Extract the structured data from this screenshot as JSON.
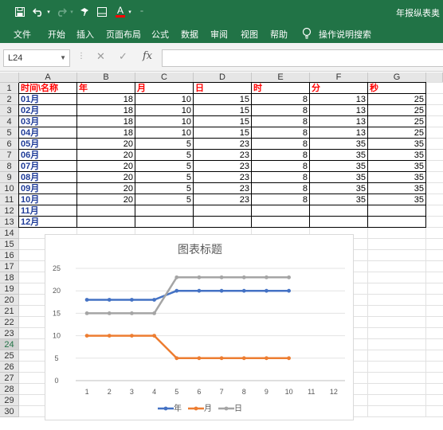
{
  "app": {
    "doc_title": "年报纵表奥"
  },
  "ribbon": {
    "tabs": [
      {
        "id": "file",
        "label": "文件"
      },
      {
        "id": "home",
        "label": "开始"
      },
      {
        "id": "insert",
        "label": "插入"
      },
      {
        "id": "layout",
        "label": "页面布局"
      },
      {
        "id": "formulas",
        "label": "公式"
      },
      {
        "id": "data",
        "label": "数据"
      },
      {
        "id": "review",
        "label": "审阅"
      },
      {
        "id": "view",
        "label": "视图"
      },
      {
        "id": "help",
        "label": "帮助"
      }
    ],
    "tell_me": "操作说明搜索"
  },
  "formula_bar": {
    "name_box": "L24",
    "fx_label": "fx",
    "formula": ""
  },
  "sheet": {
    "columns": [
      "A",
      "B",
      "C",
      "D",
      "E",
      "F",
      "G"
    ],
    "rows": [
      "1",
      "2",
      "3",
      "4",
      "5",
      "6",
      "7",
      "8",
      "9",
      "10",
      "11",
      "12",
      "13",
      "14",
      "15",
      "16",
      "17",
      "18",
      "19",
      "20",
      "21",
      "22",
      "23",
      "24",
      "25",
      "26",
      "27",
      "28",
      "29",
      "30"
    ],
    "selected_row": "24",
    "header_row": [
      "时间\\名称",
      "年",
      "月",
      "日",
      "时",
      "分",
      "秒"
    ],
    "data_rows": [
      {
        "label": "01月",
        "values": [
          "18",
          "10",
          "15",
          "8",
          "13",
          "25"
        ]
      },
      {
        "label": "02月",
        "values": [
          "18",
          "10",
          "15",
          "8",
          "13",
          "25"
        ]
      },
      {
        "label": "03月",
        "values": [
          "18",
          "10",
          "15",
          "8",
          "13",
          "25"
        ]
      },
      {
        "label": "04月",
        "values": [
          "18",
          "10",
          "15",
          "8",
          "13",
          "25"
        ]
      },
      {
        "label": "05月",
        "values": [
          "20",
          "5",
          "23",
          "8",
          "35",
          "35"
        ]
      },
      {
        "label": "06月",
        "values": [
          "20",
          "5",
          "23",
          "8",
          "35",
          "35"
        ]
      },
      {
        "label": "07月",
        "values": [
          "20",
          "5",
          "23",
          "8",
          "35",
          "35"
        ]
      },
      {
        "label": "08月",
        "values": [
          "20",
          "5",
          "23",
          "8",
          "35",
          "35"
        ]
      },
      {
        "label": "09月",
        "values": [
          "20",
          "5",
          "23",
          "8",
          "35",
          "35"
        ]
      },
      {
        "label": "10月",
        "values": [
          "20",
          "5",
          "23",
          "8",
          "35",
          "35"
        ]
      },
      {
        "label": "11月",
        "values": [
          "",
          "",
          "",
          "",
          "",
          ""
        ]
      },
      {
        "label": "12月",
        "values": [
          "",
          "",
          "",
          "",
          "",
          ""
        ]
      }
    ]
  },
  "colors": {
    "excel_green": "#217346",
    "header_red": "#ff0000",
    "label_blue": "#1f3c99",
    "series_year": "#4472c4",
    "series_month": "#ed7d31",
    "series_day": "#a5a5a5"
  },
  "chart_data": {
    "type": "line",
    "title": "图表标题",
    "x": [
      "1",
      "2",
      "3",
      "4",
      "5",
      "6",
      "7",
      "8",
      "9",
      "10",
      "11",
      "12"
    ],
    "ylim": [
      0,
      25
    ],
    "yticks": [
      0,
      5,
      10,
      15,
      20,
      25
    ],
    "grid": true,
    "legend": "bottom",
    "series": [
      {
        "name": "年",
        "color": "#4472c4",
        "values": [
          18,
          18,
          18,
          18,
          20,
          20,
          20,
          20,
          20,
          20
        ]
      },
      {
        "name": "月",
        "color": "#ed7d31",
        "values": [
          10,
          10,
          10,
          10,
          5,
          5,
          5,
          5,
          5,
          5
        ]
      },
      {
        "name": "日",
        "color": "#a5a5a5",
        "values": [
          15,
          15,
          15,
          15,
          23,
          23,
          23,
          23,
          23,
          23
        ]
      }
    ]
  }
}
